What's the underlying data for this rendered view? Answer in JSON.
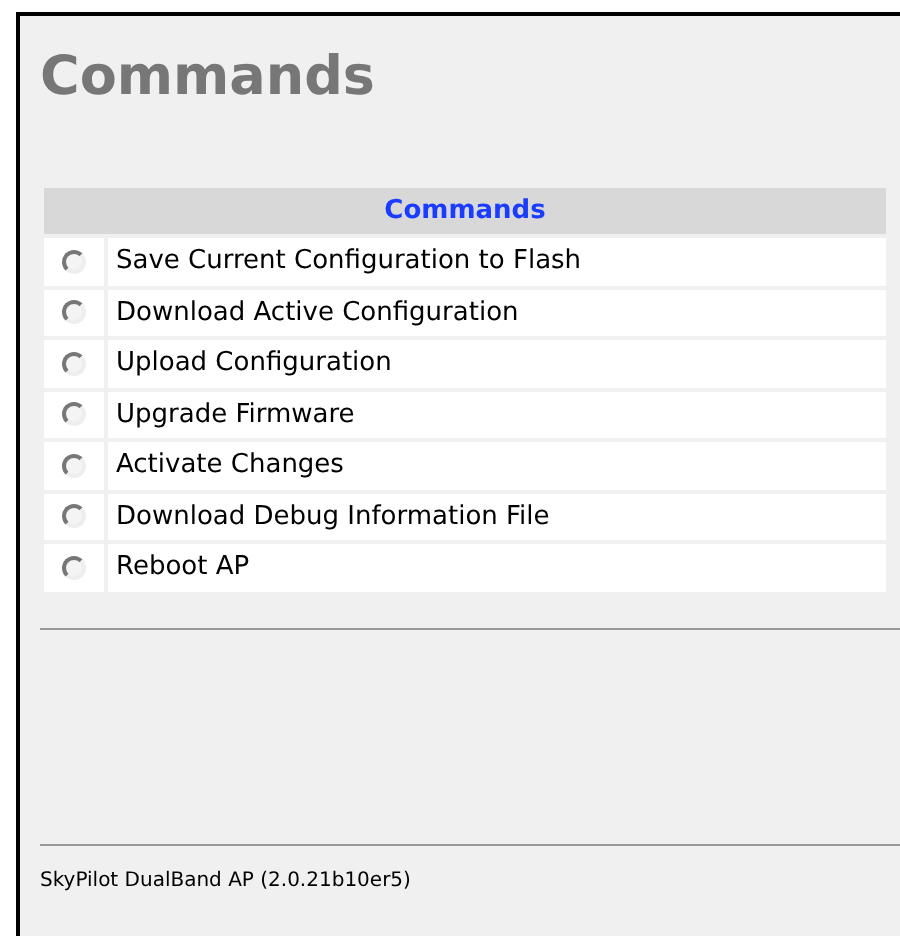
{
  "page_title": "Commands",
  "table": {
    "heading": "Commands",
    "rows": [
      {
        "label": "Save Current Configuration to Flash",
        "selected": false
      },
      {
        "label": "Download Active Configuration",
        "selected": false
      },
      {
        "label": "Upload Configuration",
        "selected": false
      },
      {
        "label": "Upgrade Firmware",
        "selected": false
      },
      {
        "label": "Activate Changes",
        "selected": false
      },
      {
        "label": "Download Debug Information File",
        "selected": false
      },
      {
        "label": "Reboot AP",
        "selected": false
      }
    ]
  },
  "footer": "SkyPilot DualBand AP (2.0.21b10er5)"
}
